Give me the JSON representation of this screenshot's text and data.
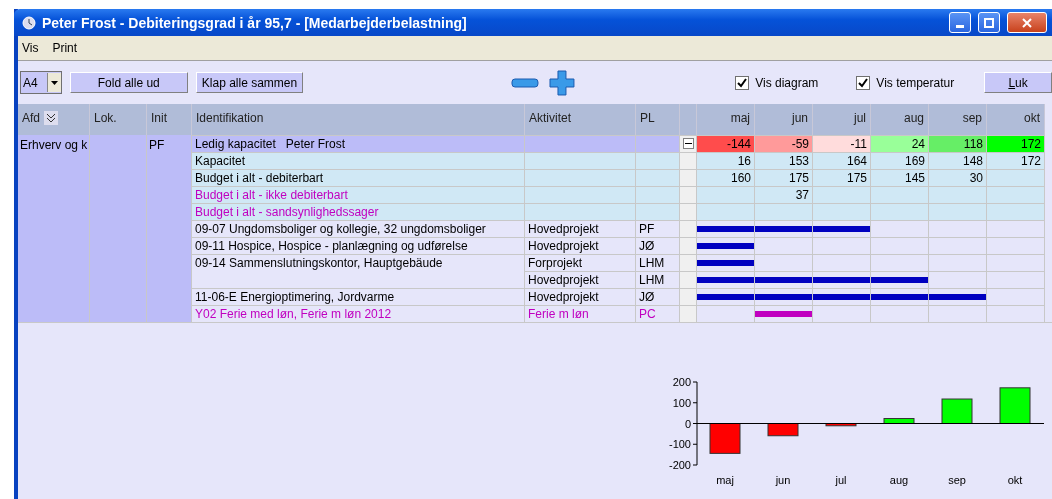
{
  "window": {
    "title": "Peter Frost - Debiteringsgrad i år 95,7 - [Medarbejderbelastning]"
  },
  "menu": [
    "Vis",
    "Print"
  ],
  "toolbar": {
    "page_size": "A4",
    "buttons": [
      "Fold alle ud",
      "Klap alle sammen"
    ],
    "checkboxes": [
      {
        "label": "Vis diagram",
        "checked": true
      },
      {
        "label": "Vis temperatur",
        "checked": true
      }
    ],
    "close_button": "Luk"
  },
  "table": {
    "columns": [
      "Afd",
      "Lok.",
      "Init",
      "Identifikation",
      "Aktivitet",
      "PL"
    ],
    "months": [
      "maj",
      "jun",
      "jul",
      "aug",
      "sep",
      "okt"
    ],
    "group": {
      "afd": "Erhverv og k",
      "init": "PF",
      "expanded": true
    },
    "rows": [
      {
        "kind": "summary",
        "ident": "Ledig kapacitet   Peter Frost",
        "cells": [
          {
            "value": "-144",
            "color": "#ff4c4c"
          },
          {
            "value": "-59",
            "color": "#ff9a9a"
          },
          {
            "value": "-11",
            "color": "#ffdcdc"
          },
          {
            "value": "24",
            "color": "#99ff99"
          },
          {
            "value": "118",
            "color": "#66ee66"
          },
          {
            "value": "172",
            "color": "#00ff00"
          }
        ]
      },
      {
        "kind": "budget",
        "ident": "Kapacitet",
        "highlight": false,
        "cells": [
          {
            "value": "16"
          },
          {
            "value": "153"
          },
          {
            "value": "164"
          },
          {
            "value": "169"
          },
          {
            "value": "148"
          },
          {
            "value": "172"
          }
        ]
      },
      {
        "kind": "budget",
        "ident": "Budget i alt - debiterbart",
        "highlight": false,
        "cells": [
          {
            "value": "160"
          },
          {
            "value": "175"
          },
          {
            "value": "175"
          },
          {
            "value": "145"
          },
          {
            "value": "30"
          }
        ]
      },
      {
        "kind": "budget",
        "ident": "Budget i alt - ikke debiterbart",
        "highlight": true,
        "cells": [
          {},
          {
            "value": "37"
          }
        ]
      },
      {
        "kind": "budget",
        "ident": "Budget i alt - sandsynlighedssager",
        "highlight": true
      },
      {
        "kind": "project",
        "ident": "09-07 Ungdomsboliger og kollegie, 32 ungdomsboliger",
        "activity": "Hovedprojekt",
        "pl": "PF",
        "highlight": false,
        "bars": [
          true,
          true,
          true,
          false,
          false,
          false
        ]
      },
      {
        "kind": "project",
        "ident": "09-11 Hospice, Hospice - planlægning og udførelse",
        "activity": "Hovedprojekt",
        "pl": "JØ",
        "highlight": false,
        "bars": [
          true,
          false,
          false,
          false,
          false,
          false
        ]
      },
      {
        "kind": "project",
        "ident": "09-14 Sammenslutningskontor, Hauptgebäude",
        "activity": "Forprojekt",
        "pl": "LHM",
        "highlight": false,
        "bars": [
          true,
          false,
          false,
          false,
          false,
          false
        ]
      },
      {
        "kind": "project",
        "activity": "Hovedprojekt",
        "pl": "LHM",
        "highlight": false,
        "bars": [
          true,
          true,
          true,
          true,
          false,
          false
        ]
      },
      {
        "kind": "project",
        "ident": "11-06-E Energioptimering, Jordvarme",
        "activity": "Hovedprojekt",
        "pl": "JØ",
        "highlight": false,
        "bars": [
          true,
          true,
          true,
          true,
          true,
          false
        ]
      },
      {
        "kind": "project",
        "ident": "Y02 Ferie med løn, Ferie m løn 2012",
        "activity": "Ferie m løn",
        "pl": "PC",
        "highlight": true,
        "bars": [
          false,
          true,
          false,
          false,
          false,
          false
        ]
      }
    ]
  },
  "chart_data": {
    "type": "bar",
    "categories": [
      "maj",
      "jun",
      "jul",
      "aug",
      "sep",
      "okt"
    ],
    "series": [
      {
        "values": [
          -144,
          -59,
          -11,
          24,
          118,
          172
        ]
      }
    ],
    "ylim": [
      -200,
      200
    ],
    "yticks": [
      -200,
      -100,
      0,
      100,
      200
    ]
  }
}
